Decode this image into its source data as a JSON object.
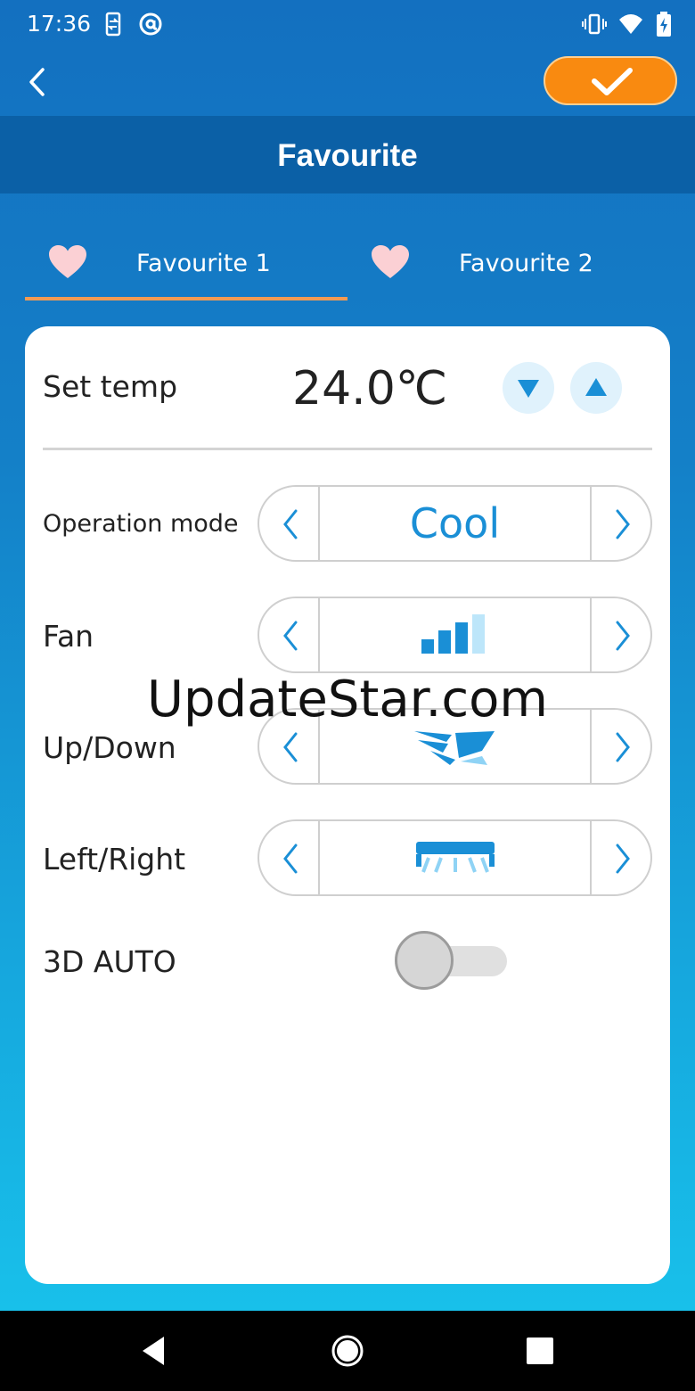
{
  "status_bar": {
    "time": "17:36",
    "icons": [
      "sync-phone-icon",
      "at-sign-icon",
      "vibrate-icon",
      "wifi-icon",
      "battery-charging-icon"
    ]
  },
  "app_bar": {
    "back_icon": "chevron-left-icon",
    "confirm_icon": "checkmark-icon",
    "confirm_color": "#f98a10"
  },
  "title": "Favourite",
  "tabs": [
    {
      "label": "Favourite 1",
      "icon": "heart-icon",
      "selected": true
    },
    {
      "label": "Favourite 2",
      "icon": "heart-icon",
      "selected": false
    }
  ],
  "card": {
    "set_temp": {
      "label": "Set temp",
      "value": "24.0℃",
      "down_icon": "triangle-down-icon",
      "up_icon": "triangle-up-icon"
    },
    "operation_mode": {
      "label": "Operation mode",
      "value": "Cool"
    },
    "fan": {
      "label": "Fan",
      "icon": "fan-speed-bars-icon",
      "level_bars_filled": 3,
      "level_bars_total": 4
    },
    "up_down": {
      "label": "Up/Down",
      "icon": "vertical-swing-icon"
    },
    "left_right": {
      "label": "Left/Right",
      "icon": "horizontal-swing-icon"
    },
    "auto_3d": {
      "label": "3D AUTO",
      "toggle_on": false
    }
  },
  "watermark": "UpdateStar.com",
  "nav_bar": {
    "icons": [
      "back-triangle-icon",
      "home-circle-icon",
      "recents-square-icon"
    ]
  },
  "colors": {
    "accent": "#1a8fd6",
    "title_bar": "#0b60a6",
    "tab_underline": "#f39a52",
    "heart": "#fbd0d4"
  }
}
